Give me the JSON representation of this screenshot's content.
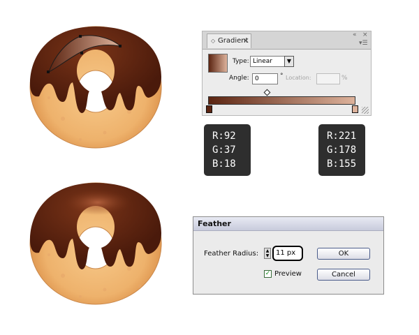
{
  "gradient_panel": {
    "tab_label": "Gradient",
    "tab_close": "×",
    "collapse_glyph": "«",
    "close_glyph": "×",
    "menu_glyph": "▾☰",
    "tab_diamond": "◇",
    "type_label": "Type:",
    "type_value": "Linear",
    "angle_label": "Angle:",
    "angle_value": "0",
    "degree_symbol": "°",
    "location_label": "Location:",
    "percent_symbol": "%",
    "colors": {
      "start": "#5c2512",
      "end": "#ddb29b"
    }
  },
  "color_badges": [
    {
      "r_label": "R:",
      "r": "92",
      "g_label": "G:",
      "g": "37",
      "b_label": "B:",
      "b": "18"
    },
    {
      "r_label": "R:",
      "r": "221",
      "g_label": "G:",
      "g": "178",
      "b_label": "B:",
      "b": "155"
    }
  ],
  "feather_dialog": {
    "title": "Feather",
    "radius_label": "Feather Radius:",
    "radius_value": "11 px",
    "preview_label": "Preview",
    "preview_checked": true,
    "ok_label": "OK",
    "cancel_label": "Cancel"
  }
}
